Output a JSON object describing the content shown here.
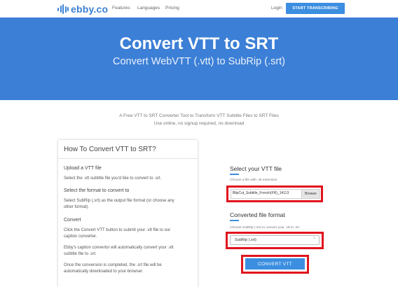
{
  "header": {
    "logo_text": "ebby.co",
    "nav": [
      "Features",
      "Languages",
      "Pricing"
    ],
    "login": "Login",
    "start_button": "START TRANSCRIBING"
  },
  "hero": {
    "title": "Convert VTT to SRT",
    "subtitle": "Convert WebVTT (.vtt) to SubRip (.srt)"
  },
  "intro": {
    "line1": "A Free VTT to SRT Converter Tool to Transform VTT Subtitle Files to SRT Files",
    "line2": "Use online, no signup required, no download"
  },
  "howto": {
    "title": "How To Convert VTT to SRT?",
    "step1_heading": "Upload a VTT file",
    "step1_text": "Select the .vtt subtitle file you'd like to convert to .srt.",
    "step2_heading": "Select the format to convert to",
    "step2_text_a": "Select SubRip (.srt) as the output file format (or choose any",
    "step2_text_b": "other format).",
    "step3_heading": "Convert",
    "step3_text_a": "Click the Convert VTT button to submit your .vtt file to our",
    "step3_text_b": "caption converter.",
    "step3_text_c": "Ebby's caption convertor will automatically convert your .vtt",
    "step3_text_d": "subtitle file to .srt.",
    "step3_text_e": "Once the conversion is completed, the .srt file will be",
    "step3_text_f": "automatically downloaded to your browser."
  },
  "converter": {
    "file_heading": "Select your VTT file",
    "file_hint": "Choose a file with .vtt extension",
    "file_name": "BlipCut_Subtitle_French(FR)_14113",
    "browse": "Browse",
    "format_heading": "Converted file format",
    "format_hint": "Choose SubRip (.srt) to convert your .vtt to .srt",
    "format_value": "SubRip (.srt)",
    "convert_button": "CONVERT VTT"
  },
  "colors": {
    "brand_blue": "#3c7fd6",
    "button_blue": "#3c8ee0",
    "highlight_red": "#e0141e"
  }
}
